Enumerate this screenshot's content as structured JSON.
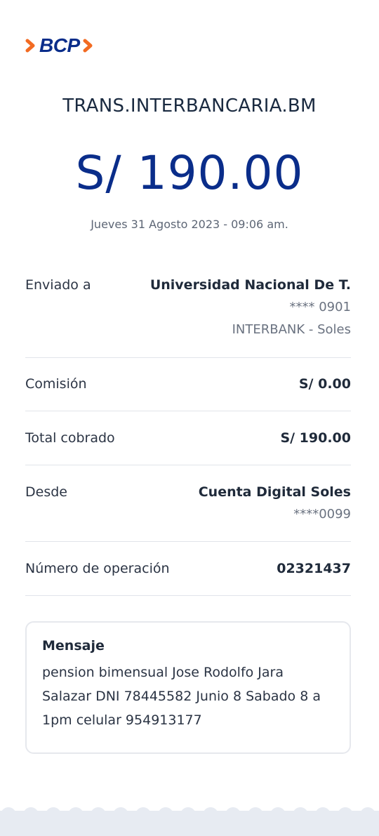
{
  "header": {
    "logo_text": "BCP",
    "logo_icon": "chevron-arrows-icon",
    "accent_color": "#f26b22",
    "brand_color": "#0a2d8a"
  },
  "receipt": {
    "title": "TRANS.INTERBANCARIA.BM",
    "amount": "S/ 190.00",
    "datetime": "Jueves 31 Agosto 2023 - 09:06 am."
  },
  "details": {
    "sent_to": {
      "label": "Enviado a",
      "name": "Universidad Nacional De T.",
      "account": "**** 0901",
      "bank": "INTERBANK - Soles"
    },
    "commission": {
      "label": "Comisión",
      "value": "S/ 0.00"
    },
    "total": {
      "label": "Total cobrado",
      "value": "S/ 190.00"
    },
    "from": {
      "label": "Desde",
      "account_name": "Cuenta Digital Soles",
      "account_number": "****0099"
    },
    "operation": {
      "label": "Número de operación",
      "value": "02321437"
    }
  },
  "message": {
    "title": "Mensaje",
    "body": "pension bimensual Jose Rodolfo Jara Salazar DNI 78445582 Junio 8 Sabado 8 a 1pm celular 954913177"
  }
}
